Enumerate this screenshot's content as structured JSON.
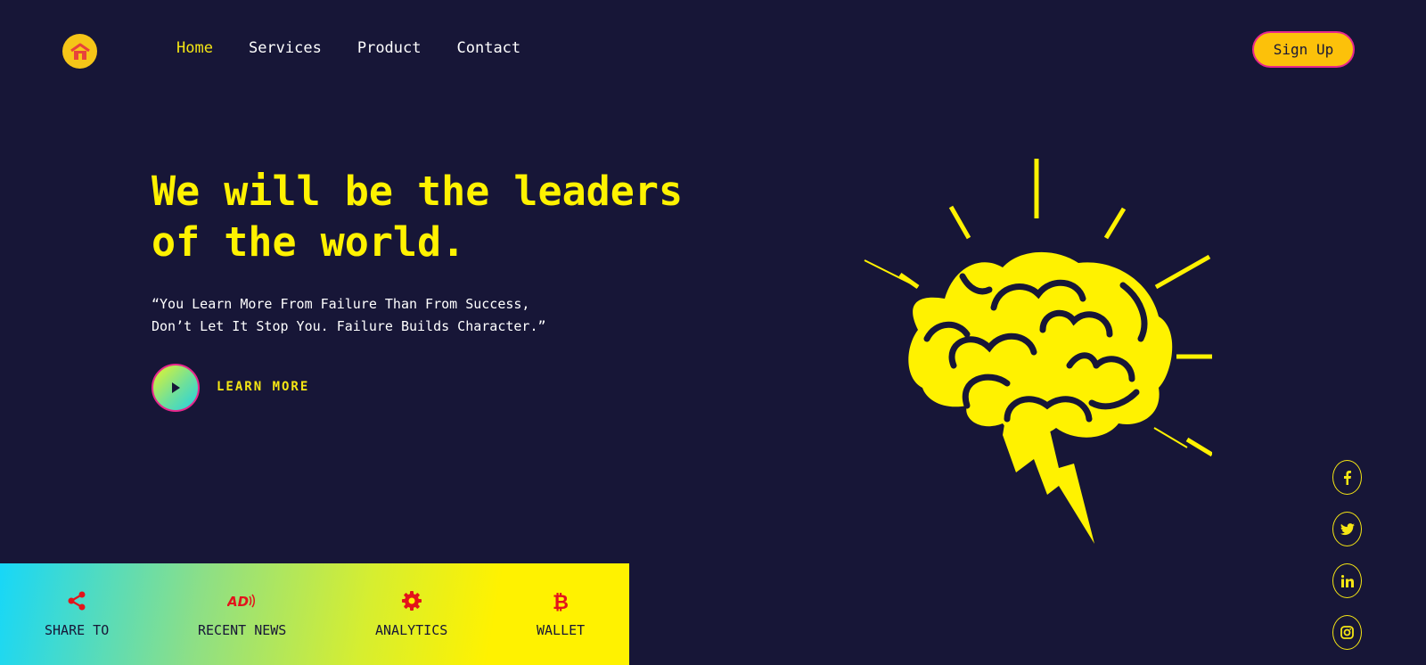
{
  "nav": {
    "items": [
      {
        "label": "Home",
        "active": true
      },
      {
        "label": "Services",
        "active": false
      },
      {
        "label": "Product",
        "active": false
      },
      {
        "label": "Contact",
        "active": false
      }
    ],
    "signup_label": "Sign Up"
  },
  "hero": {
    "title_line1": "We will be the leaders",
    "title_line2": "of the world.",
    "quote_line1": "“You Learn More From Failure Than From Success,",
    "quote_line2": "Don’t Let It Stop You. Failure Builds Character.”",
    "cta_label": "LEARN MORE"
  },
  "features": [
    {
      "label": "SHARE TO",
      "icon": "share-icon"
    },
    {
      "label": "RECENT NEWS",
      "icon": "ad-icon"
    },
    {
      "label": "ANALYTICS",
      "icon": "gear-icon"
    },
    {
      "label": "WALLET",
      "icon": "bitcoin-icon"
    }
  ],
  "social": [
    "facebook-icon",
    "twitter-icon",
    "linkedin-icon",
    "instagram-icon"
  ],
  "colors": {
    "background": "#171637",
    "accent_yellow": "#fff200",
    "accent_pink": "#e8278d",
    "icon_red": "#e3141b"
  }
}
